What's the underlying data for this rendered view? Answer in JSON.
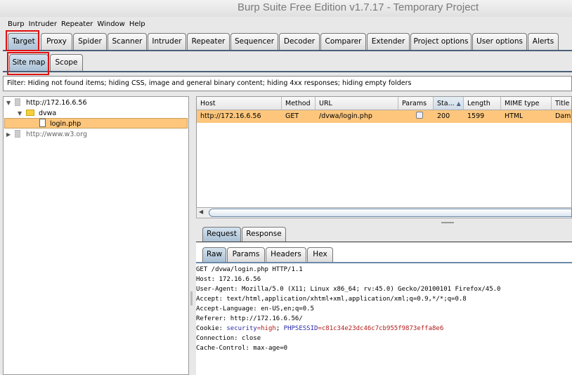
{
  "window": {
    "title": "Burp Suite Free Edition v1.7.17 - Temporary Project"
  },
  "menu": [
    "Burp",
    "Intruder",
    "Repeater",
    "Window",
    "Help"
  ],
  "main_tabs": [
    "Target",
    "Proxy",
    "Spider",
    "Scanner",
    "Intruder",
    "Repeater",
    "Sequencer",
    "Decoder",
    "Comparer",
    "Extender",
    "Project options",
    "User options",
    "Alerts"
  ],
  "sub_tabs": [
    "Site map",
    "Scope"
  ],
  "filter": "Filter:  Hiding not found items;  hiding CSS, image and general binary content;  hiding 4xx responses;  hiding empty folders",
  "tree": {
    "host1": "http://172.16.6.56",
    "folder": "dvwa",
    "file": "login.php",
    "host2": "http://www.w3.org"
  },
  "table": {
    "columns": [
      "Host",
      "Method",
      "URL",
      "Params",
      "Sta...",
      "Length",
      "MIME type",
      "Title"
    ],
    "rows": [
      {
        "host": "http://172.16.6.56",
        "method": "GET",
        "url": "/dvwa/login.php",
        "params": false,
        "status": "200",
        "length": "1599",
        "mime": "HTML",
        "title": "Dam"
      }
    ]
  },
  "message_tabs": [
    "Request",
    "Response"
  ],
  "view_tabs": [
    "Raw",
    "Params",
    "Headers",
    "Hex"
  ],
  "request": {
    "lines": [
      "GET /dvwa/login.php HTTP/1.1",
      "Host: 172.16.6.56",
      "User-Agent: Mozilla/5.0 (X11; Linux x86_64; rv:45.0) Gecko/20100101 Firefox/45.0",
      "Accept: text/html,application/xhtml+xml,application/xml;q=0.9,*/*;q=0.8",
      "Accept-Language: en-US,en;q=0.5",
      "Referer: http://172.16.6.56/"
    ],
    "cookie_label": "Cookie: ",
    "cookie_k1": "security",
    "cookie_v1": "=high",
    "cookie_sep": "; ",
    "cookie_k2": "PHPSESSID",
    "cookie_v2": "=c81c34e23dc46c7cb955f9873effa8e6",
    "lines2": [
      "Connection: close",
      "Cache-Control: max-age=0"
    ]
  }
}
